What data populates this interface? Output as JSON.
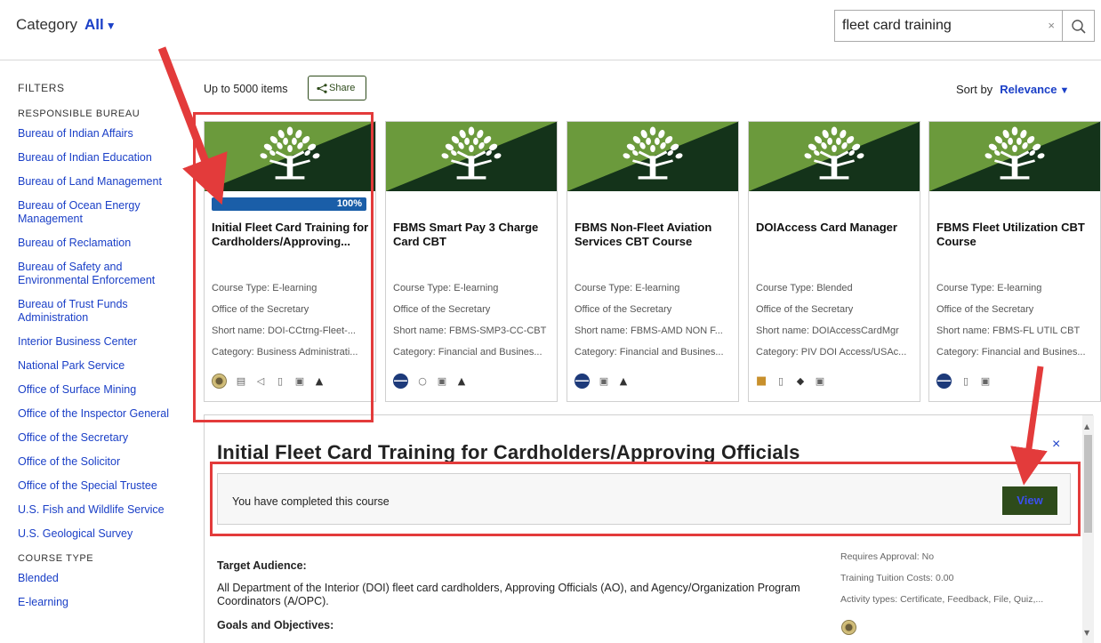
{
  "header": {
    "category_label": "Category",
    "category_value": "All",
    "search_value": "fleet card training",
    "clear_icon": "×"
  },
  "sidebar": {
    "heading": "FILTERS",
    "bureau_heading": "RESPONSIBLE BUREAU",
    "bureaus": [
      "Bureau of Indian Affairs",
      "Bureau of Indian Education",
      "Bureau of Land Management",
      "Bureau of Ocean Energy Management",
      "Bureau of Reclamation",
      "Bureau of Safety and Environmental Enforcement",
      "Bureau of Trust Funds Administration",
      "Interior Business Center",
      "National Park Service",
      "Office of Surface Mining",
      "Office of the Inspector General",
      "Office of the Secretary",
      "Office of the Solicitor",
      "Office of the Special Trustee",
      "U.S. Fish and Wildlife Service",
      "U.S. Geological Survey"
    ],
    "course_type_heading": "COURSE TYPE",
    "course_types": [
      "Blended",
      "E-learning"
    ]
  },
  "results": {
    "count": "Up to 5000 items",
    "share_label": "Share",
    "sort_label": "Sort by",
    "sort_value": "Relevance"
  },
  "cards": [
    {
      "title": "Initial Fleet Card Training for Cardholders/Approving...",
      "progress": "100%",
      "course_type": "Course Type: E-learning",
      "office": "Office of the Secretary",
      "short_name": "Short name: DOI-CCtrng-Fleet-...",
      "category": "Category: Business Administrati..."
    },
    {
      "title": "FBMS Smart Pay 3 Charge Card CBT",
      "course_type": "Course Type: E-learning",
      "office": "Office of the Secretary",
      "short_name": "Short name: FBMS-SMP3-CC-CBT",
      "category": "Category: Financial and Busines..."
    },
    {
      "title": "FBMS Non-Fleet Aviation Services CBT Course",
      "course_type": "Course Type: E-learning",
      "office": "Office of the Secretary",
      "short_name": "Short name: FBMS-AMD NON F...",
      "category": "Category: Financial and Busines..."
    },
    {
      "title": "DOIAccess Card Manager",
      "course_type": "Course Type: Blended",
      "office": "Office of the Secretary",
      "short_name": "Short name: DOIAccessCardMgr",
      "category": "Category: PIV DOI Access/USAc..."
    },
    {
      "title": "FBMS Fleet Utilization CBT Course",
      "course_type": "Course Type: E-learning",
      "office": "Office of the Secretary",
      "short_name": "Short name: FBMS-FL UTIL CBT",
      "category": "Category: Financial and Busines..."
    }
  ],
  "detail": {
    "title": "Initial Fleet Card Training for Cardholders/Approving Officials",
    "close": "×",
    "status_message": "You have completed this course",
    "view_label": "View",
    "target_audience_label": "Target Audience:",
    "target_audience_text": "All Department of the Interior (DOI) fleet card cardholders, Approving Officials (AO), and Agency/Organization Program Coordinators (A/OPC).",
    "goals_label": "Goals and Objectives:",
    "requires_approval": "Requires Approval: No",
    "tuition": "Training Tuition Costs: 0.00",
    "activity_types": "Activity types: Certificate, Feedback, File, Quiz,..."
  },
  "colors": {
    "link_blue": "#1a3fc7",
    "dark_green": "#2e4b1b",
    "progress_blue": "#1a5ea8",
    "annotation_red": "#e33b3b"
  }
}
